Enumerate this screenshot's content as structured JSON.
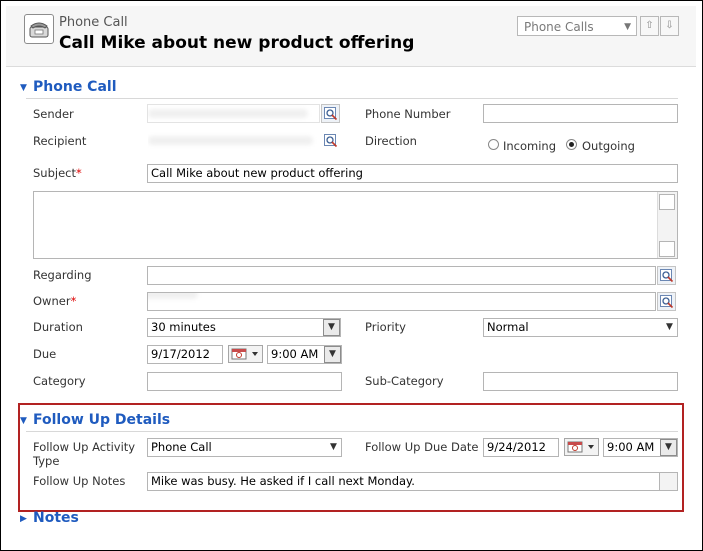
{
  "header": {
    "entity_label": "Phone Call",
    "record_title": "Call Mike about new product offering",
    "view_select": "Phone Calls"
  },
  "icons": [
    "phone-call-icon",
    "chevron-down-icon",
    "arrow-up-icon",
    "arrow-down-icon",
    "lookup-icon",
    "calendar-icon",
    "collapse-arrow-icon",
    "expand-arrow-icon"
  ],
  "section_phone_call": {
    "title": "Phone Call",
    "sender_label": "Sender",
    "phone_number_label": "Phone Number",
    "recipient_label": "Recipient",
    "direction_label": "Direction",
    "direction_incoming": "Incoming",
    "direction_outgoing": "Outgoing",
    "direction_selected": "Outgoing",
    "subject_label": "Subject",
    "subject_value": "Call Mike about new product offering",
    "regarding_label": "Regarding",
    "owner_label": "Owner",
    "duration_label": "Duration",
    "duration_value": "30 minutes",
    "priority_label": "Priority",
    "priority_value": "Normal",
    "due_label": "Due",
    "due_date": "9/17/2012",
    "due_time": "9:00 AM",
    "category_label": "Category",
    "subcategory_label": "Sub-Category",
    "required_marker": "*"
  },
  "section_follow_up": {
    "title": "Follow Up Details",
    "activity_type_label_1": "Follow Up Activity",
    "activity_type_label_2": "Type",
    "activity_type_value": "Phone Call",
    "due_date_label": "Follow Up Due Date",
    "due_date_value": "9/24/2012",
    "due_time_value": "9:00 AM",
    "notes_label": "Follow Up Notes",
    "notes_value": "Mike was busy.  He asked if I call next Monday."
  },
  "section_notes": {
    "title": "Notes"
  },
  "colors": {
    "section_title": "#1f5bbf",
    "required": "#dd0000",
    "highlight_box": "#b22222"
  }
}
